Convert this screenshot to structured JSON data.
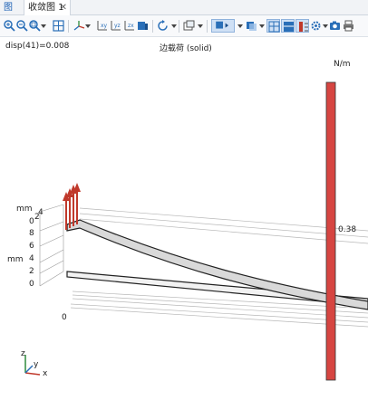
{
  "tabs": [
    {
      "label": "图形"
    },
    {
      "label": "收敛图 1"
    }
  ],
  "toolbar": {
    "buttons": [
      "zoom-in",
      "zoom-out",
      "zoom-box",
      "zoom-extents",
      "axes",
      "view-xy",
      "view-yz",
      "view-zx",
      "view-3d",
      "rotate",
      "snapshot-group",
      "scene-light",
      "transparency",
      "wireframe",
      "render",
      "legend",
      "camera",
      "print"
    ]
  },
  "plot": {
    "description": "disp(41)=0.008",
    "title": "边载荷 (solid)",
    "unit": "N/m",
    "colorbar_value": "0.38",
    "axis_unit_top": "mm",
    "axis_unit_side": "mm",
    "top_ticks": [
      "4",
      "2",
      "0"
    ],
    "side_ticks": [
      "8",
      "6",
      "4",
      "2",
      "0"
    ],
    "bottom_tick": "0",
    "triad": {
      "z": "z",
      "y": "y",
      "x": "x"
    }
  },
  "colors": {
    "bar": "#d64541",
    "arrows": "#c0392b",
    "accent": "#1a5fb4"
  }
}
